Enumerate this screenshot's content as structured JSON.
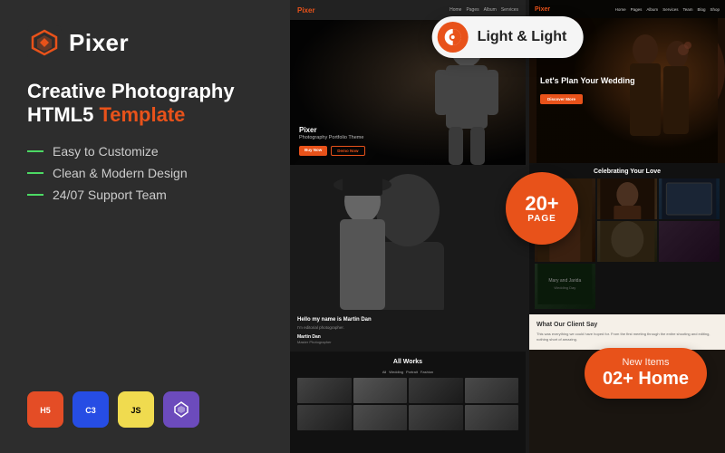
{
  "logo": {
    "text": "Pixer"
  },
  "headline": {
    "line1": "Creative Photography",
    "line2_normal": "HTML5 ",
    "line2_accent": "Template"
  },
  "features": [
    {
      "text": "Easy to Customize"
    },
    {
      "text": "Clean & Modern Design"
    },
    {
      "text": "24/07 Support Team"
    }
  ],
  "tech_badges": [
    {
      "label": "HTML5",
      "type": "html"
    },
    {
      "label": "CSS3",
      "type": "css"
    },
    {
      "label": "JS",
      "type": "js"
    },
    {
      "label": "♦",
      "type": "gem"
    }
  ],
  "light_badge": {
    "text": "Light & Light"
  },
  "page_badge": {
    "number": "20+",
    "label": "PAGE"
  },
  "new_items_badge": {
    "label": "New Items",
    "value": "02+ Home"
  },
  "left_screen": {
    "nav_logo": "Pixer",
    "hero_title": "Pixer",
    "hero_subtitle": "Photography Portfolio Theme",
    "btn1": "Buy Now",
    "btn2": "Demo Now",
    "bio_title": "Hello my name is Martin Dan",
    "bio_subtitle": "I'm editorial photographer.",
    "bio_name": "Martin Dan",
    "bio_role": "Master Photographer",
    "works_title": "All Works"
  },
  "right_screen": {
    "nav_logo": "Pixer",
    "nav_links": [
      "Home",
      "Pages",
      "Album",
      "Services",
      "Team",
      "Blog",
      "Shop"
    ],
    "hero_title": "Let's Plan Your Wedding",
    "hero_btn": "Discover More",
    "celebrating_title": "Celebrating Your Love",
    "testimonial_title": "What Our Client Say",
    "testimonial_text": "This was everything we could have hoped for. From the first meeting through the entire shooting and editing, nothing short of amazing."
  }
}
